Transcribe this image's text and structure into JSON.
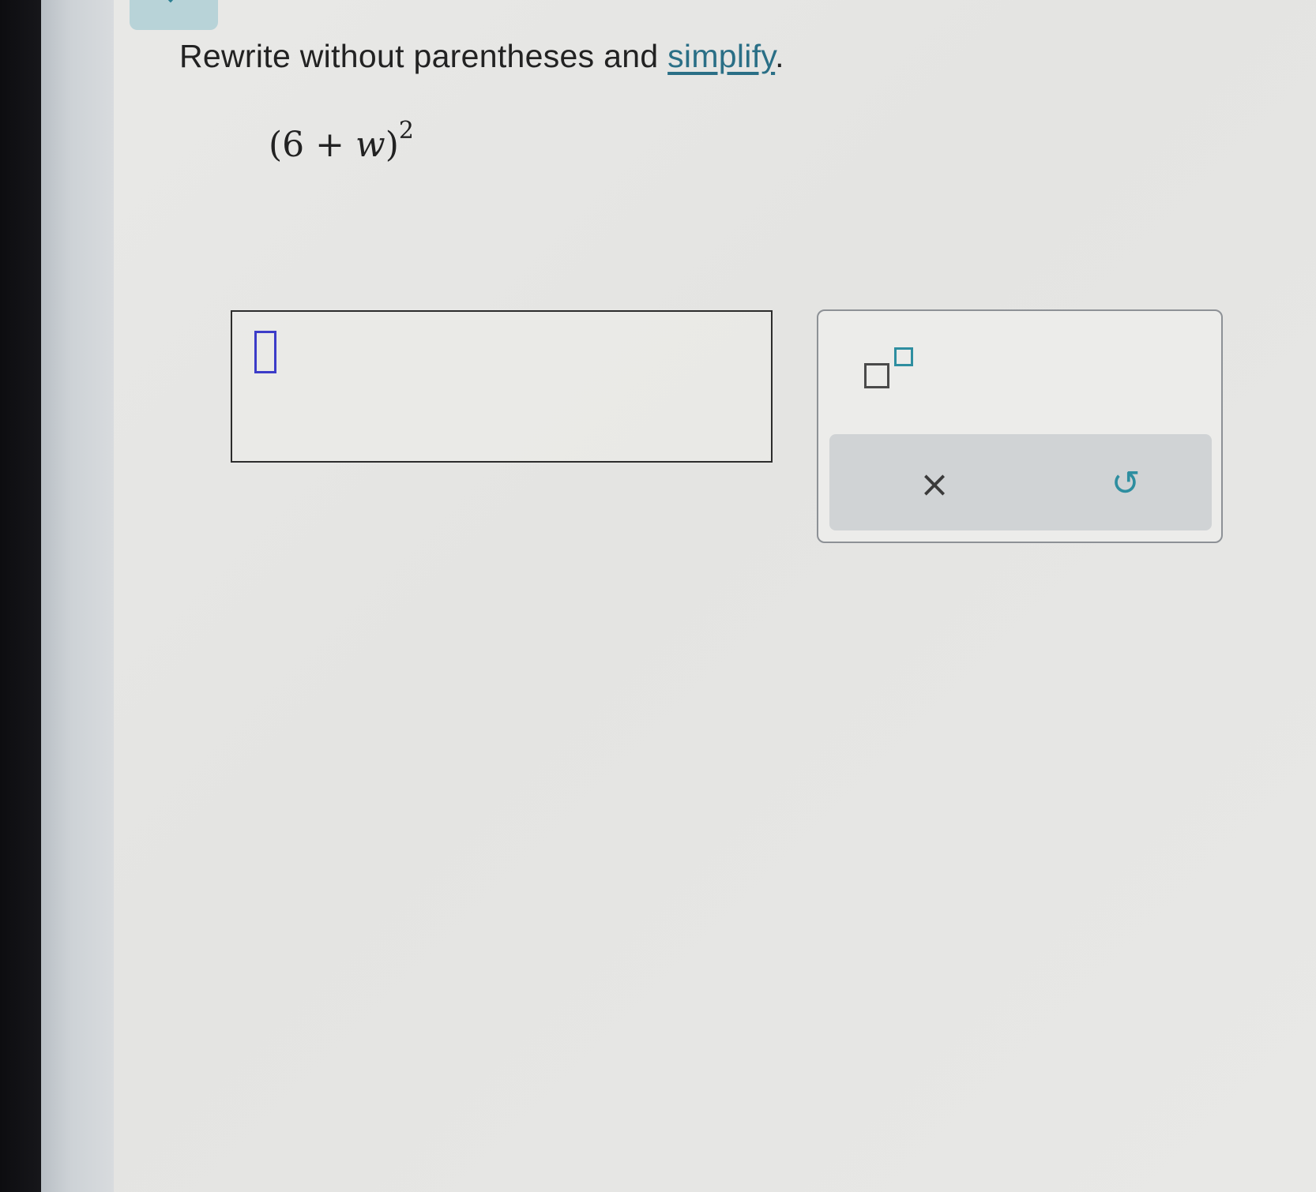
{
  "question": {
    "prompt_prefix": "Rewrite without parentheses and ",
    "prompt_link": "simplify",
    "prompt_suffix": ".",
    "expression": {
      "open_paren": "(",
      "constant": "6",
      "operator": " + ",
      "variable": "w",
      "close_paren": ")",
      "exponent": "2"
    }
  },
  "answer_input": {
    "value": ""
  },
  "keypad": {
    "exponent_button_icon": "superscript-template-icon",
    "clear_label": "×",
    "clear_icon": "close-icon",
    "undo_label": "↺",
    "undo_icon": "undo-icon"
  },
  "colors": {
    "accent": "#2e8ea0",
    "link": "#2a6f86",
    "cursor": "#3c3cc8"
  }
}
